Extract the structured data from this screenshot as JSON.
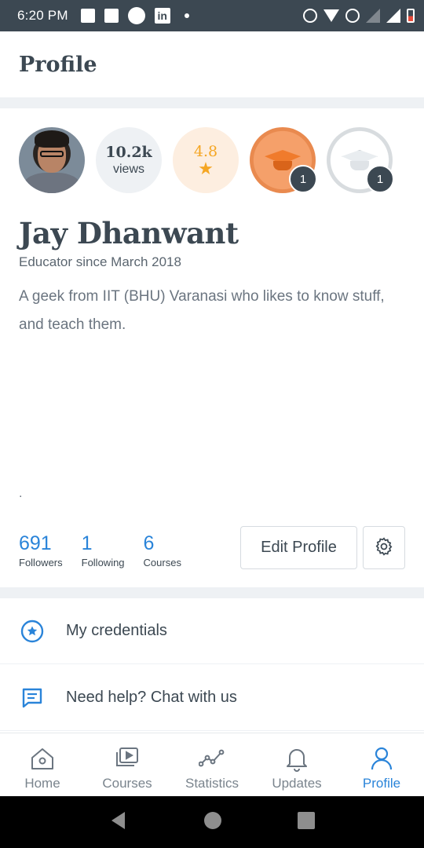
{
  "status_bar": {
    "time": "6:20 PM",
    "linkedin_label": "in"
  },
  "header": {
    "title": "Profile"
  },
  "profile": {
    "views_count": "10.2k",
    "views_label": "views",
    "rating": "4.8",
    "badge_orange_count": "1",
    "badge_grey_count": "1",
    "name": "Jay Dhanwant",
    "since": "Educator since March 2018",
    "bio": "A geek from IIT (BHU) Varanasi who likes to know stuff, and teach them.",
    "extra": "."
  },
  "stats": [
    {
      "value": "691",
      "label": "Followers"
    },
    {
      "value": "1",
      "label": "Following"
    },
    {
      "value": "6",
      "label": "Courses"
    }
  ],
  "actions": {
    "edit_profile": "Edit Profile"
  },
  "menu": [
    {
      "label": "My credentials",
      "icon": "credentials-icon"
    },
    {
      "label": "Need help? Chat with us",
      "icon": "chat-icon"
    }
  ],
  "bottom_nav": [
    {
      "label": "Home",
      "icon": "home-icon",
      "active": false
    },
    {
      "label": "Courses",
      "icon": "courses-icon",
      "active": false
    },
    {
      "label": "Statistics",
      "icon": "statistics-icon",
      "active": false
    },
    {
      "label": "Updates",
      "icon": "bell-icon",
      "active": false
    },
    {
      "label": "Profile",
      "icon": "profile-icon",
      "active": true
    }
  ],
  "colors": {
    "accent": "#2a84d9",
    "text": "#3c4852",
    "rating": "#f5a623",
    "status_bar": "#3c4852"
  }
}
